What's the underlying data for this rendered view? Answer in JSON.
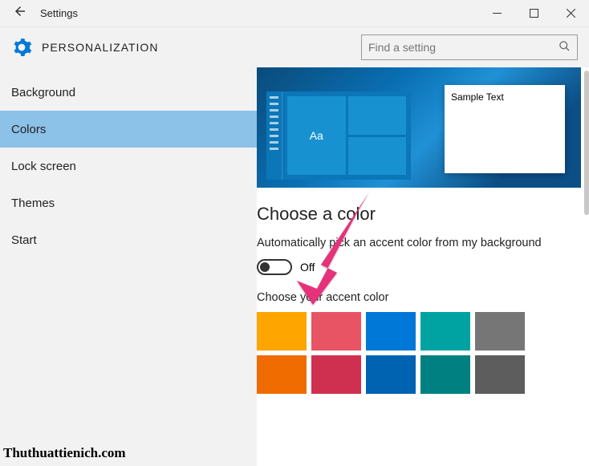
{
  "titlebar": {
    "title": "Settings"
  },
  "header": {
    "section": "PERSONALIZATION",
    "search_placeholder": "Find a setting"
  },
  "sidebar": {
    "items": [
      {
        "label": "Background"
      },
      {
        "label": "Colors"
      },
      {
        "label": "Lock screen"
      },
      {
        "label": "Themes"
      },
      {
        "label": "Start"
      }
    ],
    "selected_index": 1
  },
  "main": {
    "preview": {
      "sample_text": "Sample Text",
      "tile_label": "Aa"
    },
    "section_title": "Choose a color",
    "auto_pick_label": "Automatically pick an accent color from my background",
    "toggle_state": "Off",
    "accent_label": "Choose your accent color",
    "swatches_row1": [
      "#ffa500",
      "#e85464",
      "#0078d7",
      "#00a2a2",
      "#767676"
    ],
    "swatches_row2": [
      "#f06c00",
      "#d03050",
      "#0063b1",
      "#008080",
      "#5d5d5d"
    ]
  },
  "watermark": "Thuthuattienich.com"
}
